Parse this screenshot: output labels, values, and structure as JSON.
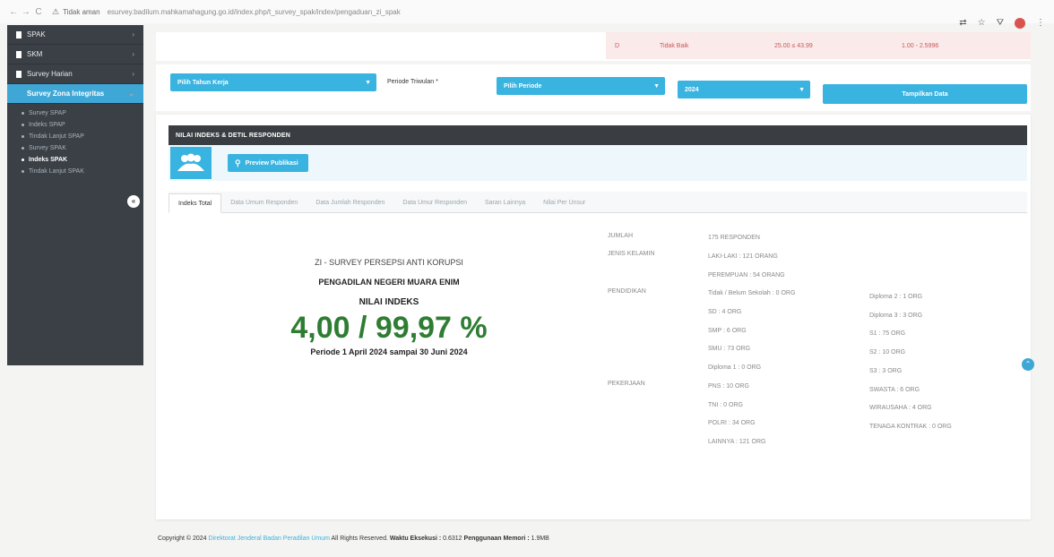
{
  "browser": {
    "back": "←",
    "forward": "→",
    "reload": "C",
    "insecure": "Tidak aman",
    "url": "esurvey.badilum.mahkamahagung.go.id/index.php/t_survey_spak/index/pengaduan_zi_spak",
    "icons": [
      "translate-icon",
      "star-icon",
      "extensions-icon",
      "profile-icon",
      "menu-icon"
    ]
  },
  "sidebar": {
    "items": [
      {
        "label": "SPAK"
      },
      {
        "label": "SKM"
      },
      {
        "label": "Survey Harian"
      },
      {
        "label": "Survey Zona Integritas",
        "active": true
      }
    ],
    "subitems": [
      {
        "label": "Survey SPAP"
      },
      {
        "label": "Indeks SPAP"
      },
      {
        "label": "Tindak Lanjut SPAP"
      },
      {
        "label": "Survey SPAK"
      },
      {
        "label": "Indeks SPAK",
        "current": true
      },
      {
        "label": "Tindak Lanjut SPAK"
      }
    ],
    "collapse": "«"
  },
  "top_strip": {
    "col1": "D",
    "col2": "Tidak Baik",
    "col3": "25.00 ≤ 43.99",
    "col4": "1.00 - 2.5996"
  },
  "filters": {
    "year_select": "Pilih Tahun Kerja",
    "period_label": "Periode Triwulan *",
    "period_select": "Pilih Periode",
    "year_value": "2024",
    "show_button": "Tampilkan Data"
  },
  "panel": {
    "header": "NILAI INDEKS & DETIL RESPONDEN",
    "preview_button": "Preview Publikasi"
  },
  "tabs": [
    {
      "label": "Indeks Total",
      "active": true
    },
    {
      "label": "Data Umum Responden"
    },
    {
      "label": "Data Jumlah Responden"
    },
    {
      "label": "Data Umur Responden"
    },
    {
      "label": "Saran Lainnya"
    },
    {
      "label": "Nilai Per Unsur"
    }
  ],
  "index": {
    "survey_title": "ZI - SURVEY PERSEPSI ANTI KORUPSI",
    "court": "PENGADILAN NEGERI MUARA ENIM",
    "label": "NILAI INDEKS",
    "value": "4,00 / 99,97 %",
    "period": "Periode 1 April 2024 sampai 30 Juni 2024"
  },
  "stats": {
    "jumlah_label": "JUMLAH",
    "jumlah_value": "175 RESPONDEN",
    "gender_label": "JENIS KELAMIN",
    "male": "LAKI-LAKI : 121 ORANG",
    "female": "PEREMPUAN : 54 ORANG",
    "education_label": "PENDIDIKAN",
    "edu_left": [
      "Tidak / Belum Sekolah : 0 ORG",
      "SD : 4 ORG",
      "SMP : 6 ORG",
      "SMU : 73 ORG",
      "Diploma 1 : 0 ORG"
    ],
    "edu_right": [
      "Diploma 2 : 1 ORG",
      "Diploma 3 : 3 ORG",
      "S1 : 75 ORG",
      "S2 : 10 ORG",
      "S3 : 3 ORG"
    ],
    "job_label": "PEKERJAAN",
    "job_left": [
      "PNS : 10 ORG",
      "TNI : 0 ORG",
      "POLRI : 34 ORG",
      "LAINNYA : 121 ORG"
    ],
    "job_right": [
      "SWASTA : 6 ORG",
      "WIRAUSAHA : 4 ORG",
      "TENAGA KONTRAK : 0 ORG"
    ]
  },
  "footer": {
    "copyright": "Copyright © 2024",
    "link": "Direktorat Jenderal Badan Peradilan Umum",
    "rights": "All Rights Reserved.",
    "time_label": "Waktu Eksekusi :",
    "time_value": "0.6312",
    "mem_label": "Penggunaan Memori :",
    "mem_value": "1.9MB"
  }
}
